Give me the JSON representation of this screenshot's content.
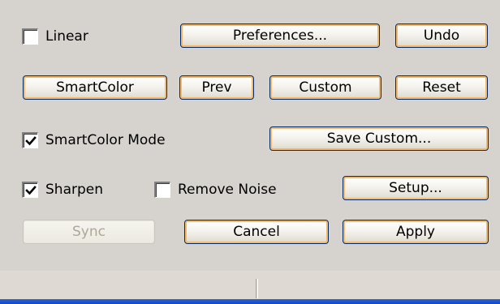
{
  "options": {
    "linear_label": "Linear",
    "linear_checked": false,
    "smartcolor_mode_label": "SmartColor Mode",
    "smartcolor_mode_checked": true,
    "sharpen_label": "Sharpen",
    "sharpen_checked": true,
    "remove_noise_label": "Remove Noise",
    "remove_noise_checked": false
  },
  "buttons": {
    "preferences": "Preferences...",
    "undo": "Undo",
    "smartcolor": "SmartColor",
    "prev": "Prev",
    "custom": "Custom",
    "reset": "Reset",
    "save_custom": "Save Custom...",
    "setup": "Setup...",
    "sync": "Sync",
    "cancel": "Cancel",
    "apply": "Apply"
  },
  "status": {
    "panel1": "",
    "panel2": ""
  }
}
